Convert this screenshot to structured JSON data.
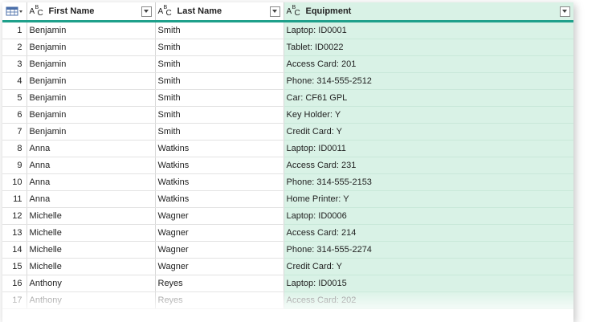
{
  "columns": [
    {
      "label": "First Name",
      "type": "ABC"
    },
    {
      "label": "Last Name",
      "type": "ABC"
    },
    {
      "label": "Equipment",
      "type": "ABC"
    }
  ],
  "colors": {
    "selected_column_bg": "#d9f2e6",
    "header_accent": "#1fa08b"
  },
  "rows": [
    {
      "idx": "1",
      "first": "Benjamin",
      "last": "Smith",
      "equipment": "Laptop: ID0001"
    },
    {
      "idx": "2",
      "first": "Benjamin",
      "last": "Smith",
      "equipment": "Tablet: ID0022"
    },
    {
      "idx": "3",
      "first": "Benjamin",
      "last": "Smith",
      "equipment": "Access Card: 201"
    },
    {
      "idx": "4",
      "first": "Benjamin",
      "last": "Smith",
      "equipment": "Phone: 314-555-2512"
    },
    {
      "idx": "5",
      "first": "Benjamin",
      "last": "Smith",
      "equipment": "Car: CF61 GPL"
    },
    {
      "idx": "6",
      "first": "Benjamin",
      "last": "Smith",
      "equipment": "Key Holder: Y"
    },
    {
      "idx": "7",
      "first": "Benjamin",
      "last": "Smith",
      "equipment": "Credit Card: Y"
    },
    {
      "idx": "8",
      "first": "Anna",
      "last": "Watkins",
      "equipment": "Laptop: ID0011"
    },
    {
      "idx": "9",
      "first": "Anna",
      "last": "Watkins",
      "equipment": "Access Card: 231"
    },
    {
      "idx": "10",
      "first": "Anna",
      "last": "Watkins",
      "equipment": "Phone: 314-555-2153"
    },
    {
      "idx": "11",
      "first": "Anna",
      "last": "Watkins",
      "equipment": "Home Printer: Y"
    },
    {
      "idx": "12",
      "first": "Michelle",
      "last": "Wagner",
      "equipment": "Laptop: ID0006"
    },
    {
      "idx": "13",
      "first": "Michelle",
      "last": "Wagner",
      "equipment": "Access Card: 214"
    },
    {
      "idx": "14",
      "first": "Michelle",
      "last": "Wagner",
      "equipment": "Phone: 314-555-2274"
    },
    {
      "idx": "15",
      "first": "Michelle",
      "last": "Wagner",
      "equipment": "Credit Card: Y"
    },
    {
      "idx": "16",
      "first": "Anthony",
      "last": "Reyes",
      "equipment": "Laptop: ID0015"
    },
    {
      "idx": "17",
      "first": "Anthony",
      "last": "Reyes",
      "equipment": "Access Card: 202"
    }
  ]
}
